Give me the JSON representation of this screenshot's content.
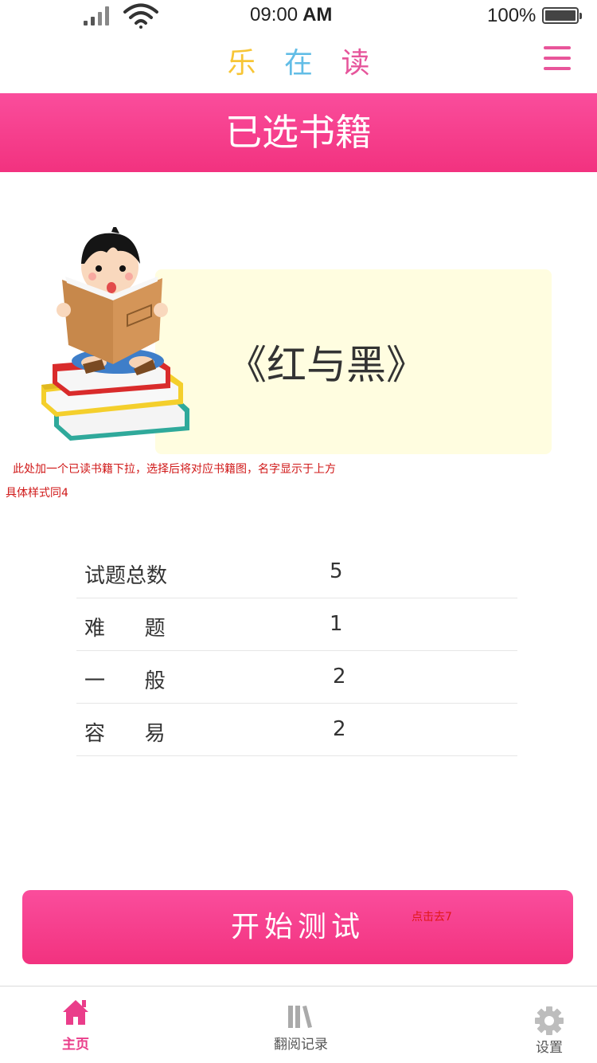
{
  "status_bar": {
    "time": "09:00",
    "ampm": "AM",
    "battery": "100%"
  },
  "app": {
    "title_chars": [
      "乐",
      "在",
      "读"
    ],
    "title_colors": [
      "#f7c535",
      "#62bde6",
      "#e6559b"
    ]
  },
  "header": {
    "title": "已选书籍"
  },
  "book": {
    "title": "《红与黑》"
  },
  "notes": {
    "dropdown_note": "此处加一个已读书籍下拉，选择后将对应书籍图，名字显示于上方",
    "style_note": "具体样式同4",
    "button_note": "点击去7"
  },
  "stats": [
    {
      "label": "试题总数",
      "value": "5"
    },
    {
      "label": "难      题",
      "value": "1"
    },
    {
      "label": "一      般",
      "value": "2"
    },
    {
      "label": "容      易",
      "value": "2"
    }
  ],
  "start_button": {
    "label": "开始测试"
  },
  "tab_bar": {
    "items": [
      {
        "label": "主页",
        "icon": "home-icon",
        "active": true
      },
      {
        "label": "翻阅记录",
        "icon": "books-icon",
        "active": false
      },
      {
        "label": "设置",
        "icon": "gear-icon",
        "active": false
      }
    ]
  },
  "colors": {
    "accent": "#f2327f",
    "card": "#fffde0",
    "note": "#d01818"
  }
}
